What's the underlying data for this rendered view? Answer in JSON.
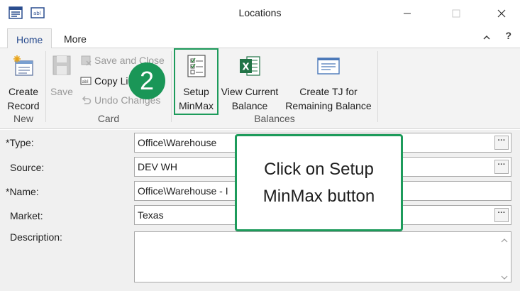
{
  "window": {
    "title": "Locations"
  },
  "tabs": [
    {
      "label": "Home",
      "active": true
    },
    {
      "label": "More",
      "active": false
    }
  ],
  "ribbon": {
    "new_group": {
      "label": "New",
      "create_record": "Create Record"
    },
    "card_group": {
      "label": "Card",
      "save": "Save",
      "save_and_close": "Save and Close",
      "copy_line": "Copy Li",
      "undo_changes": "Undo Changes"
    },
    "balances_group": {
      "label": "Balances",
      "setup_minmax_line1": "Setup",
      "setup_minmax_line2": "MinMax",
      "view_balance_line1": "View Current",
      "view_balance_line2": "Balance",
      "create_tj_line1": "Create TJ for",
      "create_tj_line2": "Remaining Balance"
    }
  },
  "step_badge": "2",
  "callout": {
    "text": "Click on Setup MinMax button"
  },
  "form": {
    "type_label": "*Type:",
    "type_value": "Office\\Warehouse",
    "source_label": "Source:",
    "source_value": "DEV WH",
    "name_label": "*Name:",
    "name_value": "Office\\Warehouse - I",
    "market_label": "Market:",
    "market_value": "Texas",
    "description_label": "Description:",
    "lookup_glyph": "···"
  },
  "colors": {
    "accent_green": "#1d9b5b",
    "badge_green": "#1a9657",
    "tab_active_text": "#2a4d8f"
  }
}
